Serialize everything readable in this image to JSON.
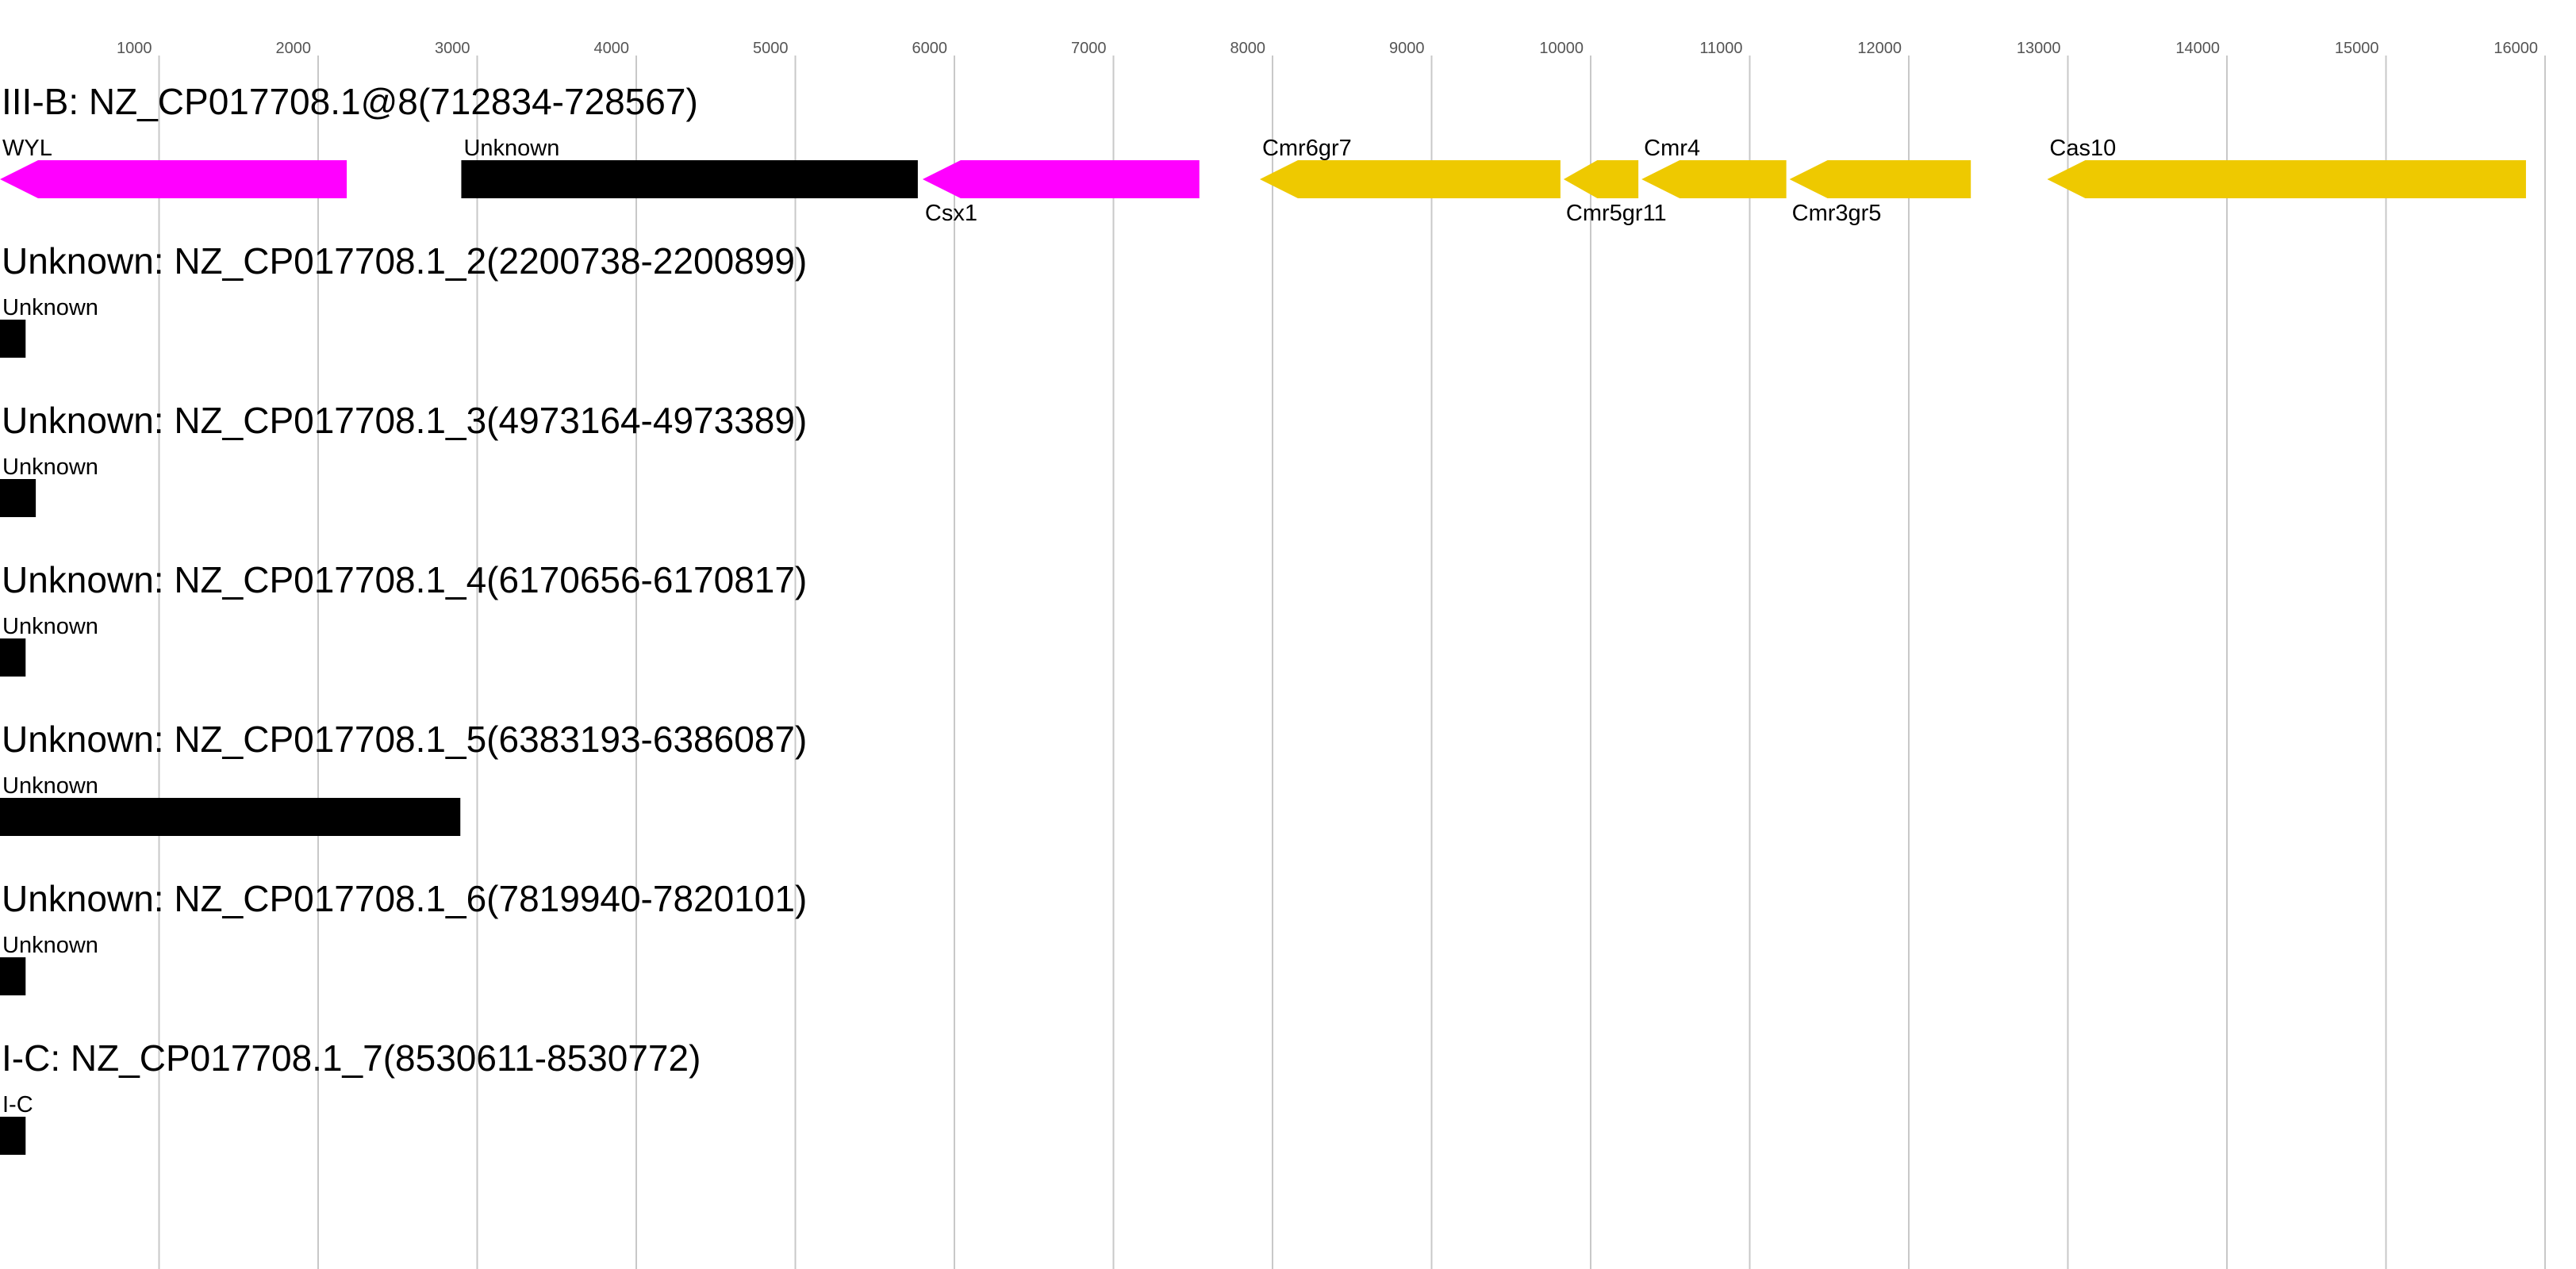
{
  "axis": {
    "ticks": [
      1000,
      2000,
      3000,
      4000,
      5000,
      6000,
      7000,
      8000,
      9000,
      10000,
      11000,
      12000,
      13000,
      14000,
      15000,
      16000
    ],
    "range": [
      0,
      16200
    ]
  },
  "colors": {
    "magenta": "#ff00ff",
    "black": "#000000",
    "yellow": "#eec900",
    "gridline": "#c8c8c8",
    "tick_label": "#555555"
  },
  "loci": [
    {
      "title": "III-B: NZ_CP017708.1@8(712834-728567)",
      "genes": [
        {
          "label": "WYL",
          "start": 0,
          "end": 2180,
          "strand": "-",
          "color": "magenta",
          "label_pos": "above"
        },
        {
          "label": "Unknown",
          "start": 2900,
          "end": 5770,
          "strand": "0",
          "color": "black",
          "label_pos": "above"
        },
        {
          "label": "Csx1",
          "start": 5800,
          "end": 7540,
          "strand": "-",
          "color": "magenta",
          "label_pos": "below"
        },
        {
          "label": "Cmr6gr7",
          "start": 7920,
          "end": 9810,
          "strand": "-",
          "color": "yellow",
          "label_pos": "above"
        },
        {
          "label": "Cmr5gr11",
          "start": 9830,
          "end": 10300,
          "strand": "-",
          "color": "yellow",
          "label_pos": "below"
        },
        {
          "label": "Cmr4",
          "start": 10320,
          "end": 11230,
          "strand": "-",
          "color": "yellow",
          "label_pos": "above"
        },
        {
          "label": "Cmr3gr5",
          "start": 11250,
          "end": 12390,
          "strand": "-",
          "color": "yellow",
          "label_pos": "below"
        },
        {
          "label": "Cas10",
          "start": 12870,
          "end": 15880,
          "strand": "-",
          "color": "yellow",
          "label_pos": "above"
        }
      ]
    },
    {
      "title": "Unknown: NZ_CP017708.1_2(2200738-2200899)",
      "genes": [
        {
          "label": "Unknown",
          "start": 0,
          "end": 161,
          "strand": "0",
          "color": "black",
          "label_pos": "above"
        }
      ]
    },
    {
      "title": "Unknown: NZ_CP017708.1_3(4973164-4973389)",
      "genes": [
        {
          "label": "Unknown",
          "start": 0,
          "end": 225,
          "strand": "0",
          "color": "black",
          "label_pos": "above"
        }
      ]
    },
    {
      "title": "Unknown: NZ_CP017708.1_4(6170656-6170817)",
      "genes": [
        {
          "label": "Unknown",
          "start": 0,
          "end": 161,
          "strand": "0",
          "color": "black",
          "label_pos": "above"
        }
      ]
    },
    {
      "title": "Unknown: NZ_CP017708.1_5(6383193-6386087)",
      "genes": [
        {
          "label": "Unknown",
          "start": 0,
          "end": 2894,
          "strand": "0",
          "color": "black",
          "label_pos": "above"
        }
      ]
    },
    {
      "title": "Unknown: NZ_CP017708.1_6(7819940-7820101)",
      "genes": [
        {
          "label": "Unknown",
          "start": 0,
          "end": 161,
          "strand": "0",
          "color": "black",
          "label_pos": "above"
        }
      ]
    },
    {
      "title": "I-C: NZ_CP017708.1_7(8530611-8530772)",
      "genes": [
        {
          "label": "I-C",
          "start": 0,
          "end": 161,
          "strand": "0",
          "color": "black",
          "label_pos": "above"
        }
      ]
    }
  ]
}
